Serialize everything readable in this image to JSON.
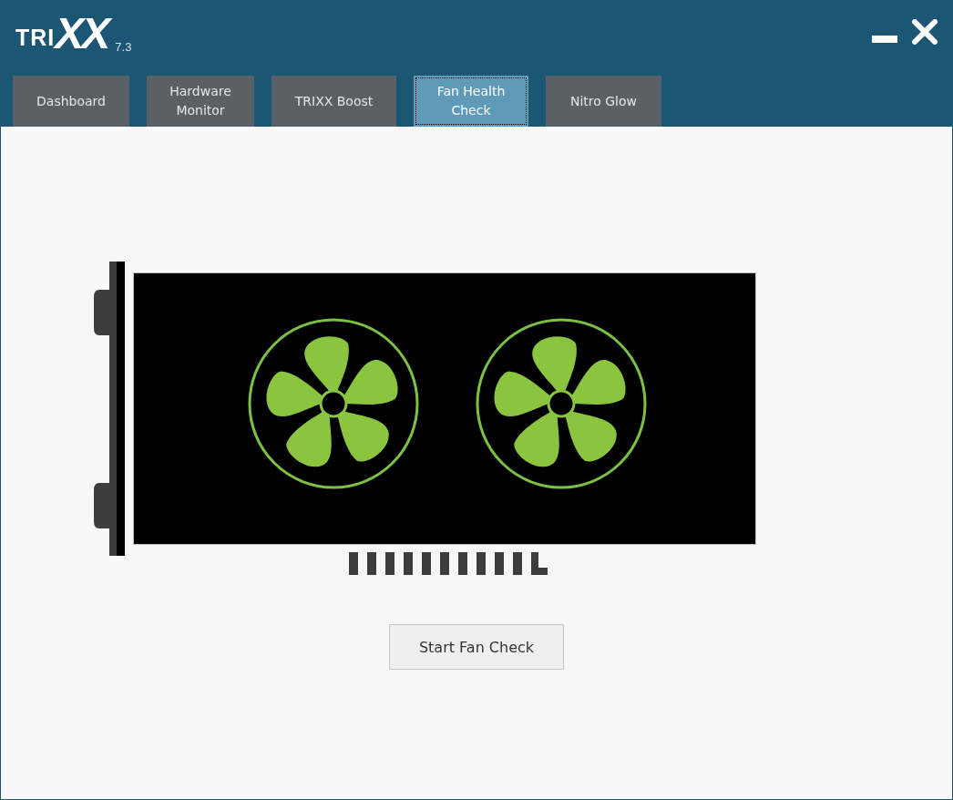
{
  "logo": {
    "prefix": "TRI",
    "emphasis": "XX",
    "version": "7.3"
  },
  "tabs": [
    {
      "label": "Dashboard",
      "selected": false
    },
    {
      "label": "Hardware Monitor",
      "selected": false
    },
    {
      "label": "TRIXX Boost",
      "selected": false
    },
    {
      "label": "Fan Health Check",
      "selected": true
    },
    {
      "label": "Nitro Glow",
      "selected": false
    }
  ],
  "action_button": {
    "label": "Start Fan Check"
  }
}
